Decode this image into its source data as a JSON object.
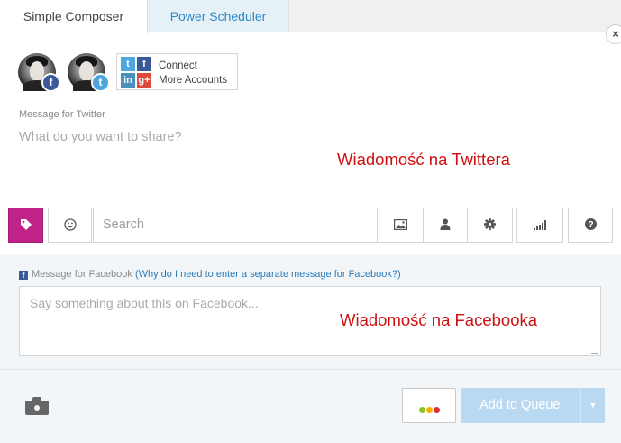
{
  "tabs": [
    {
      "label": "Simple Composer",
      "active": true
    },
    {
      "label": "Power Scheduler",
      "active": false
    }
  ],
  "close_label": "×",
  "profiles": [
    {
      "network": "facebook",
      "badge": "f"
    },
    {
      "network": "twitter",
      "badge": "t"
    }
  ],
  "connect": {
    "line1": "Connect",
    "line2": "More Accounts",
    "icons": [
      "twitter-icon",
      "facebook-icon",
      "linkedin-icon",
      "googleplus-icon"
    ],
    "icon_glyphs": {
      "twitter": "t",
      "facebook": "f",
      "linkedin": "in",
      "googleplus": "g+"
    }
  },
  "twitter": {
    "label": "Message for Twitter",
    "placeholder": "What do you want to share?",
    "annotation": "Wiadomość na Twittera"
  },
  "toolbar": {
    "search_placeholder": "Search",
    "icons": [
      "tag-icon",
      "smiley-icon",
      "image-icon",
      "user-icon",
      "gear-icon",
      "signal-icon",
      "help-icon"
    ],
    "help_glyph": "?"
  },
  "facebook": {
    "label": "Message for Facebook",
    "why_text": "(Why do I need to enter a separate message for Facebook?)",
    "placeholder": "Say something about this on Facebook...",
    "annotation": "Wiadomość na Facebooka"
  },
  "bottom": {
    "queue_label": "Add to Queue",
    "dots_colors": [
      "#8fc31f",
      "#f0b400",
      "#e03030"
    ]
  },
  "colors": {
    "accent_magenta": "#c0228a",
    "link_blue": "#2a89c5",
    "annotation_red": "#cc1111",
    "facebook_blue": "#3b5998",
    "twitter_blue": "#4da7de",
    "queue_button": "#b8d9f1"
  }
}
